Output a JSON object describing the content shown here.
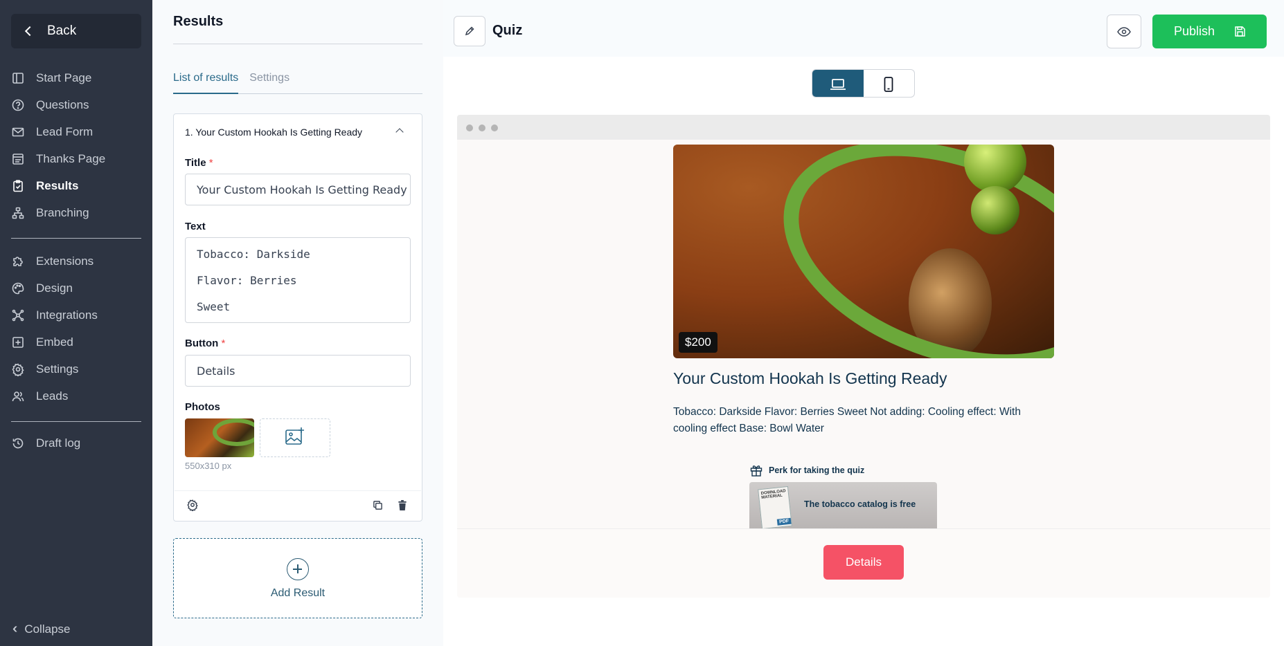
{
  "sidebar": {
    "back_label": "Back",
    "items": [
      {
        "label": "Start Page",
        "icon": "start-page-icon"
      },
      {
        "label": "Questions",
        "icon": "question-icon"
      },
      {
        "label": "Lead Form",
        "icon": "mail-icon"
      },
      {
        "label": "Thanks Page",
        "icon": "thanks-page-icon"
      },
      {
        "label": "Results",
        "icon": "clipboard-check-icon",
        "active": true
      },
      {
        "label": "Branching",
        "icon": "branching-icon"
      },
      {
        "label": "Extensions",
        "icon": "puzzle-icon"
      },
      {
        "label": "Design",
        "icon": "palette-icon"
      },
      {
        "label": "Integrations",
        "icon": "integrations-icon"
      },
      {
        "label": "Embed",
        "icon": "embed-icon"
      },
      {
        "label": "Settings",
        "icon": "gear-icon"
      },
      {
        "label": "Leads",
        "icon": "users-icon"
      },
      {
        "label": "Draft log",
        "icon": "history-icon"
      }
    ],
    "collapse_label": "Collapse"
  },
  "panel": {
    "title": "Results",
    "tabs": [
      {
        "label": "List of results",
        "active": true
      },
      {
        "label": "Settings",
        "active": false
      }
    ],
    "result": {
      "header": "1. Your Custom Hookah Is Getting Ready",
      "title_label": "Title",
      "title_value": "Your Custom Hookah Is Getting Ready",
      "text_label": "Text",
      "text_lines": [
        "Tobacco: Darkside",
        "Flavor: Berries",
        "Sweet"
      ],
      "button_label": "Button",
      "button_value": "Details",
      "photos_label": "Photos",
      "photo_size": "550x310 px",
      "required_mark": "*"
    },
    "add_result_label": "Add Result"
  },
  "topbar": {
    "quiz_title": "Quiz",
    "publish_label": "Publish"
  },
  "preview": {
    "price": "$200",
    "title": "Your Custom Hookah Is Getting Ready",
    "text": "Tobacco: Darkside Flavor: Berries Sweet Not adding: Cooling effect: With cooling effect Base: Bowl Water",
    "perk_heading": "Perk for taking the quiz",
    "perk_text": "The tobacco catalog is free",
    "perk_book_text": "DOWNLOAD MATERIAL",
    "perk_book_badge": "PDF",
    "button_label": "Details"
  },
  "colors": {
    "sidebar_bg": "#2d3442",
    "accent": "#2a6a8a",
    "publish_green": "#1dbf5a",
    "details_button": "#f55266",
    "device_active": "#1f5b7a"
  }
}
